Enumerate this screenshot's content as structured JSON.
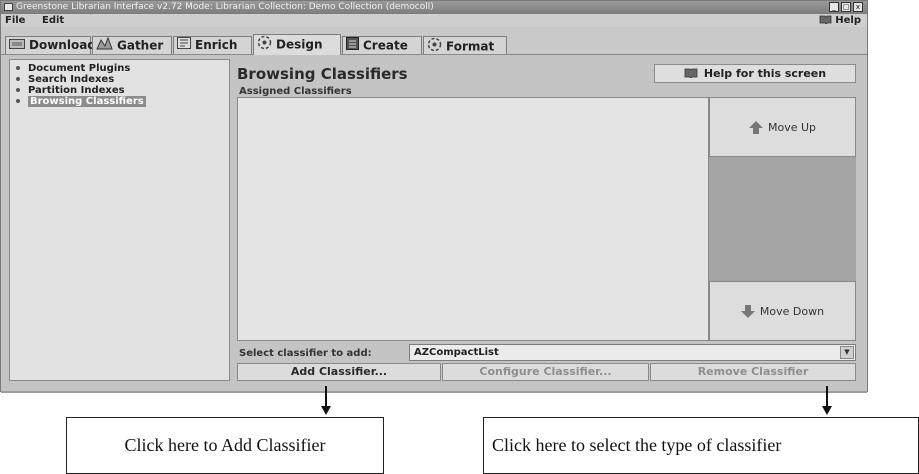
{
  "window": {
    "title": "Greenstone Librarian Interface v2.72  Mode: Librarian  Collection: Demo Collection (democoll)",
    "controls": [
      "_",
      "□",
      "x"
    ]
  },
  "menubar": {
    "file": "File",
    "edit": "Edit",
    "help": "Help"
  },
  "tabs": [
    {
      "label": "Download",
      "icon": "download-icon"
    },
    {
      "label": "Gather",
      "icon": "gather-icon"
    },
    {
      "label": "Enrich",
      "icon": "enrich-icon"
    },
    {
      "label": "Design",
      "icon": "design-icon",
      "active": true
    },
    {
      "label": "Create",
      "icon": "create-icon"
    },
    {
      "label": "Format",
      "icon": "format-icon"
    }
  ],
  "sidebar": {
    "items": [
      {
        "label": "Document Plugins"
      },
      {
        "label": "Search Indexes"
      },
      {
        "label": "Partition Indexes"
      },
      {
        "label": "Browsing Classifiers",
        "selected": true
      }
    ]
  },
  "main": {
    "title": "Browsing Classifiers",
    "help_button": "Help for this screen",
    "assigned_label": "Assigned Classifiers",
    "move_up": "Move Up",
    "move_down": "Move Down",
    "select_label": "Select classifier to add:",
    "select_value": "AZCompactList",
    "add_button": "Add Classifier...",
    "configure_button": "Configure Classifier...",
    "remove_button": "Remove Classifier"
  },
  "annotations": {
    "add_callout": "Click here to Add Classifier",
    "select_callout": "Click here to select the type of classifier"
  },
  "colors": {
    "window_bg": "#c6c6c6",
    "list_bg": "#e4e4e4",
    "button_column": "#a5a5a5",
    "disabled_text": "#8e8e8e"
  }
}
